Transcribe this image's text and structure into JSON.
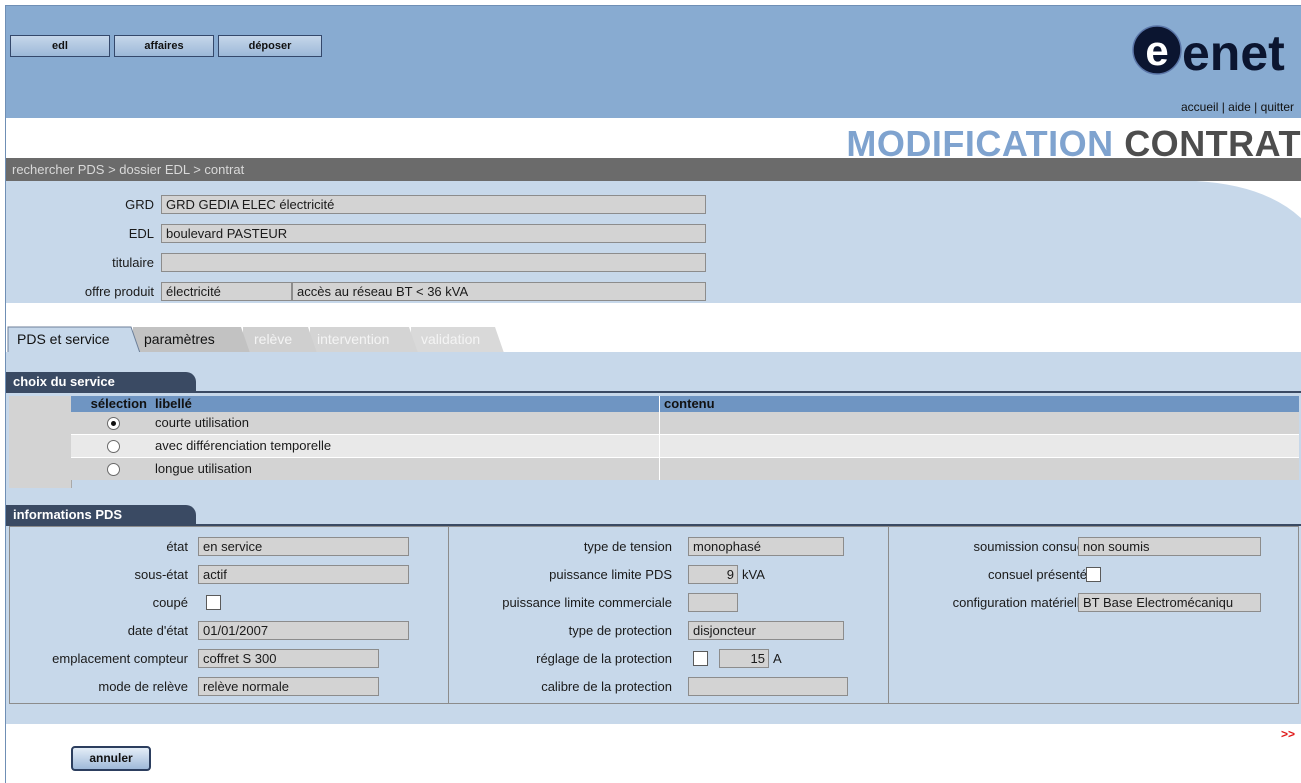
{
  "nav": {
    "edl": "edl",
    "affaires": "affaires",
    "deposer": "déposer"
  },
  "logo": {
    "text": "enet"
  },
  "toplinks": {
    "accueil": "accueil",
    "sep": " | ",
    "aide": "aide",
    "quitter": "quitter"
  },
  "title": {
    "part1": "MODIFICATION",
    "part2": "CONTRAT"
  },
  "breadcrumb": "rechercher PDS > dossier EDL > contrat",
  "header": {
    "grd_label": "GRD",
    "grd_value": "GRD GEDIA ELEC électricité",
    "edl_label": "EDL",
    "edl_value": "boulevard PASTEUR",
    "titulaire_label": "titulaire",
    "titulaire_value": "",
    "offre_label": "offre produit",
    "offre_value1": "électricité",
    "offre_value2": "accès au réseau BT < 36 kVA"
  },
  "tabs": [
    {
      "label": "PDS et service",
      "state": "active"
    },
    {
      "label": "paramètres",
      "state": "enabled"
    },
    {
      "label": "relève",
      "state": "disabled"
    },
    {
      "label": "intervention",
      "state": "disabled"
    },
    {
      "label": "validation",
      "state": "disabled"
    }
  ],
  "service": {
    "section_title": "choix du service",
    "col_selection": "sélection",
    "col_libelle": "libellé",
    "col_contenu": "contenu",
    "rows": [
      {
        "libelle": "courte utilisation",
        "contenu": "",
        "selected": true
      },
      {
        "libelle": "avec différenciation temporelle",
        "contenu": "",
        "selected": false
      },
      {
        "libelle": "longue utilisation",
        "contenu": "",
        "selected": false
      }
    ]
  },
  "info": {
    "section_title": "informations PDS",
    "etat_label": "état",
    "etat_value": "en service",
    "sousetat_label": "sous-état",
    "sousetat_value": "actif",
    "coupe_label": "coupé",
    "coupe_checked": false,
    "date_label": "date d'état",
    "date_value": "01/01/2007",
    "emplacement_label": "emplacement compteur",
    "emplacement_value": "coffret S 300",
    "mode_label": "mode de relève",
    "mode_value": "relève normale",
    "tension_label": "type de tension",
    "tension_value": "monophasé",
    "plpds_label": "puissance limite PDS",
    "plpds_value": "9",
    "plpds_unit": "kVA",
    "plcom_label": "puissance limite commerciale",
    "plcom_value": "",
    "protection_label": "type de protection",
    "protection_value": "disjoncteur",
    "reglage_label": "réglage de la protection",
    "reglage_checked": false,
    "reglage_value": "15",
    "reglage_unit": "A",
    "calibre_label": "calibre de la protection",
    "calibre_value": "",
    "soumission_label": "soumission consuel",
    "soumission_value": "non soumis",
    "consuel_label": "consuel présenté",
    "consuel_checked": false,
    "config_label": "configuration matérielle",
    "config_value": "BT Base Electromécaniqu"
  },
  "footer": {
    "cancel": "annuler",
    "more": ">>"
  },
  "colors": {
    "topbar": "#88abd1",
    "panel": "#c7d8ea",
    "section": "#3a4a63",
    "gridhead": "#6f95c2",
    "title_light": "#7fa3cf",
    "title_dark": "#4d4d4d"
  }
}
